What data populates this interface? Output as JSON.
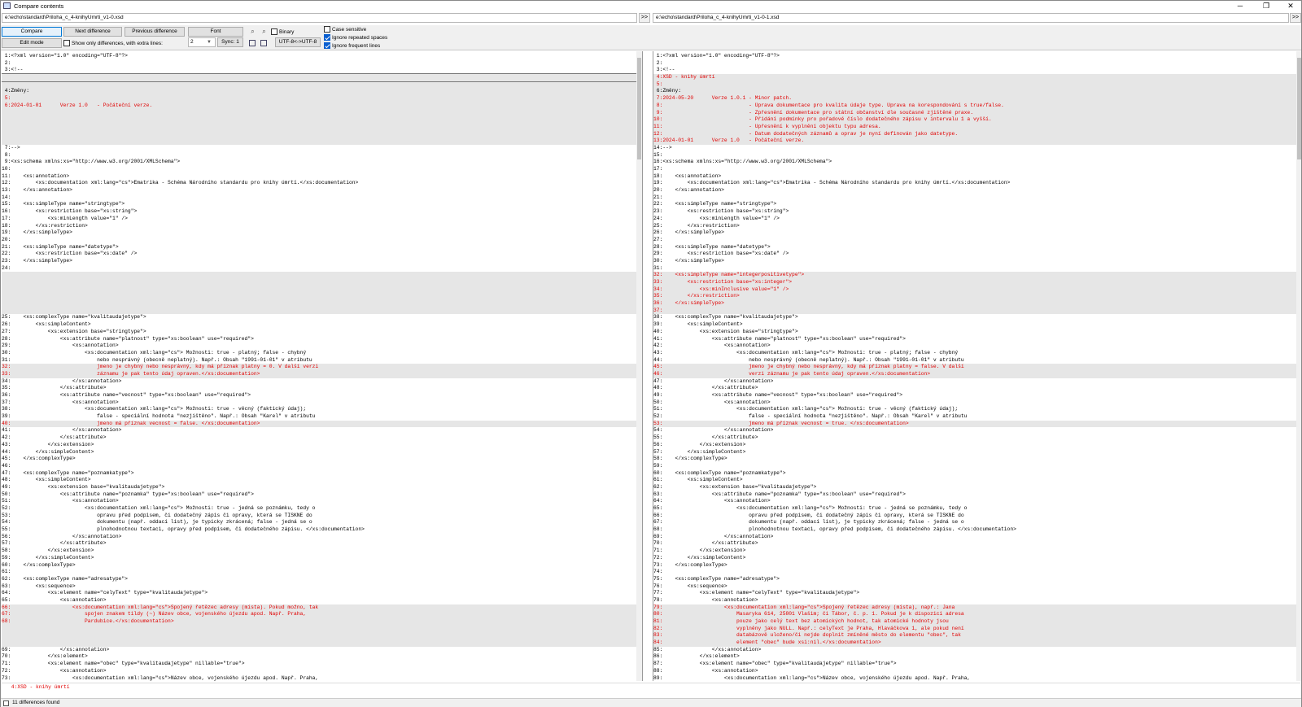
{
  "window": {
    "title": "Compare contents",
    "minimize": "─",
    "maximize": "❐",
    "close": "✕"
  },
  "paths": {
    "left": "e:\\echo\\standard\\Priloha_c_4-knihyUmrti_v1-0.xsd",
    "right": "e:\\echo\\standard\\Priloha_c_4-knihyUmrti_v1-0-1.xsd",
    "go_label": ">>"
  },
  "toolbar": {
    "compare": "Compare",
    "next_difference": "Next difference",
    "previous_difference": "Previous difference",
    "font": "Font",
    "edit_mode": "Edit mode",
    "sync": "Sync: 1",
    "encoding": "UTF-8<->UTF-8",
    "binary": "Binary",
    "show_only_differences": "Show only differences, with extra lines:",
    "context_lines": "2",
    "case_sensitive": "Case sensitive",
    "ignore_repeated_spaces": "Ignore repeated spaces",
    "ignore_frequent_lines": "Ignore frequent lines"
  },
  "checkbox_states": {
    "binary": false,
    "show_only_differences": false,
    "case_sensitive": false,
    "ignore_repeated_spaces": true,
    "ignore_frequent_lines": true
  },
  "left_lines": [
    {
      "t": " 1:<?xml version=\"1.0\" encoding=\"UTF-8\"?>"
    },
    {
      "t": " 2:"
    },
    {
      "t": " 3:<!--"
    },
    {
      "t": "",
      "d": true,
      "cur": true
    },
    {
      "t": "",
      "d": true
    },
    {
      "t": " 4:Změny:",
      "d": true
    },
    {
      "t": " 5:",
      "d": true,
      "r": true
    },
    {
      "t": " 6:2024-01-01      Verze 1.0   - Počáteční verze.",
      "d": true,
      "r": true
    },
    {
      "t": "",
      "d": true
    },
    {
      "t": "",
      "d": true
    },
    {
      "t": "",
      "d": true
    },
    {
      "t": "",
      "d": true
    },
    {
      "t": "",
      "d": true
    },
    {
      "t": " 7:-->"
    },
    {
      "t": " 8:"
    },
    {
      "t": " 9:<xs:schema xmlns:xs=\"http://www.w3.org/2001/XMLSchema\">"
    },
    {
      "t": "10:"
    },
    {
      "t": "11:    <xs:annotation>"
    },
    {
      "t": "12:        <xs:documentation xml:lang=\"cs\">Ematrika - Schéma Národního standardu pro knihy úmrtí.</xs:documentation>"
    },
    {
      "t": "13:    </xs:annotation>"
    },
    {
      "t": "14:"
    },
    {
      "t": "15:    <xs:simpleType name=\"stringtype\">"
    },
    {
      "t": "16:        <xs:restriction base=\"xs:string\">"
    },
    {
      "t": "17:            <xs:minLength value=\"1\" />"
    },
    {
      "t": "18:        </xs:restriction>"
    },
    {
      "t": "19:    </xs:simpleType>"
    },
    {
      "t": "20:"
    },
    {
      "t": "21:    <xs:simpleType name=\"datetype\">"
    },
    {
      "t": "22:        <xs:restriction base=\"xs:date\" />"
    },
    {
      "t": "23:    </xs:simpleType>"
    },
    {
      "t": "24:"
    },
    {
      "t": "",
      "d": true
    },
    {
      "t": "",
      "d": true
    },
    {
      "t": "",
      "d": true
    },
    {
      "t": "",
      "d": true
    },
    {
      "t": "",
      "d": true
    },
    {
      "t": "",
      "d": true
    },
    {
      "t": "25:    <xs:complexType name=\"kvalitaudajetype\">"
    },
    {
      "t": "26:        <xs:simpleContent>"
    },
    {
      "t": "27:            <xs:extension base=\"stringtype\">"
    },
    {
      "t": "28:                <xs:attribute name=\"platnost\" type=\"xs:boolean\" use=\"required\">"
    },
    {
      "t": "29:                    <xs:annotation>"
    },
    {
      "t": "30:                        <xs:documentation xml:lang=\"cs\"> Možnosti: true - platný; false - chybný"
    },
    {
      "t": "31:                            nebo nesprávný (obecně neplatný). Např.: Obsah \"1991-01-01\" v atributu"
    },
    {
      "t": "32:                            jmeno je chybný nebo nesprávný, kdy má příznak platny = 0. V další verzi",
      "d": true,
      "r": true
    },
    {
      "t": "33:                            záznamu je pak tento údaj opraven.</xs:documentation>",
      "d": true,
      "r": true
    },
    {
      "t": "34:                    </xs:annotation>"
    },
    {
      "t": "35:                </xs:attribute>"
    },
    {
      "t": "36:                <xs:attribute name=\"vecnost\" type=\"xs:boolean\" use=\"required\">"
    },
    {
      "t": "37:                    <xs:annotation>"
    },
    {
      "t": "38:                        <xs:documentation xml:lang=\"cs\"> Možnosti: true - věcný (faktický údaj);"
    },
    {
      "t": "39:                            false - speciální hodnota \"nezjištěno\". Např.: Obsah \"Karel\" v atributu"
    },
    {
      "t": "40:                            jmeno má příznak vecnost = false. </xs:documentation>",
      "d": true,
      "r": true
    },
    {
      "t": "41:                    </xs:annotation>"
    },
    {
      "t": "42:                </xs:attribute>"
    },
    {
      "t": "43:            </xs:extension>"
    },
    {
      "t": "44:        </xs:simpleContent>"
    },
    {
      "t": "45:    </xs:complexType>"
    },
    {
      "t": "46:"
    },
    {
      "t": "47:    <xs:complexType name=\"poznamkatype\">"
    },
    {
      "t": "48:        <xs:simpleContent>"
    },
    {
      "t": "49:            <xs:extension base=\"kvalitaudajetype\">"
    },
    {
      "t": "50:                <xs:attribute name=\"poznamka\" type=\"xs:boolean\" use=\"required\">"
    },
    {
      "t": "51:                    <xs:annotation>"
    },
    {
      "t": "52:                        <xs:documentation xml:lang=\"cs\"> Možnosti: true - jedná se poznámku, tedy o"
    },
    {
      "t": "53:                            opravu před podpisem, či dodatečný zápis či opravy, která se TISKNE do"
    },
    {
      "t": "54:                            dokumentu (např. oddací list), je typicky zkrácená; false - jedná se o"
    },
    {
      "t": "55:                            plnohodnotnou textaci, opravy před podpisem, či dodatečného zápisu. </xs:documentation>"
    },
    {
      "t": "56:                    </xs:annotation>"
    },
    {
      "t": "57:                </xs:attribute>"
    },
    {
      "t": "58:            </xs:extension>"
    },
    {
      "t": "59:        </xs:simpleContent>"
    },
    {
      "t": "60:    </xs:complexType>"
    },
    {
      "t": "61:"
    },
    {
      "t": "62:    <xs:complexType name=\"adresatype\">"
    },
    {
      "t": "63:        <xs:sequence>"
    },
    {
      "t": "64:            <xs:element name=\"celyText\" type=\"kvalitaudajetype\">"
    },
    {
      "t": "65:                <xs:annotation>"
    },
    {
      "t": "66:                    <xs:documentation xml:lang=\"cs\">Spojený řetězec adresy (místa). Pokud možno, tak",
      "d": true,
      "r": true
    },
    {
      "t": "67:                        spojen znakem tildy (~) Název obce, vojenského újezdu apod. Např. Praha,",
      "d": true,
      "r": true
    },
    {
      "t": "68:                        Pardubice.</xs:documentation>",
      "d": true,
      "r": true
    },
    {
      "t": "",
      "d": true
    },
    {
      "t": "",
      "d": true
    },
    {
      "t": "",
      "d": true
    },
    {
      "t": "69:                </xs:annotation>"
    },
    {
      "t": "70:            </xs:element>"
    },
    {
      "t": "71:            <xs:element name=\"obec\" type=\"kvalitaudajetype\" nillable=\"true\">"
    },
    {
      "t": "72:                <xs:annotation>"
    },
    {
      "t": "73:                    <xs:documentation xml:lang=\"cs\">Název obce, vojenského újezdu apod. Např. Praha,"
    }
  ],
  "right_lines": [
    {
      "t": " 1:<?xml version=\"1.0\" encoding=\"UTF-8\"?>"
    },
    {
      "t": " 2:"
    },
    {
      "t": " 3:<!--"
    },
    {
      "t": " 4:XSD - knihy úmrtí",
      "d": true,
      "r": true
    },
    {
      "t": " 5:",
      "d": true,
      "r": true
    },
    {
      "t": " 6:Změny:",
      "d": true
    },
    {
      "t": " 7:2024-05-20      Verze 1.0.1 - Minor patch.",
      "d": true,
      "r": true
    },
    {
      "t": " 8:                            - Úprava dokumentace pro kvalita údaje type. Úprava na korespondování s true/false.",
      "d": true,
      "r": true
    },
    {
      "t": " 9:                            - Zpřesnění dokumentace pro státní občanství dle současné zjištěné praxe.",
      "d": true,
      "r": true
    },
    {
      "t": "10:                            - Přidání podmínky pro pořadové číslo dodatečného zápisu v intervalu 1 a vyšší.",
      "d": true,
      "r": true
    },
    {
      "t": "11:                            - Upřesnění k vyplnění objektu typu adresa.",
      "d": true,
      "r": true
    },
    {
      "t": "12:                            - Datum dodatečných záznamů a oprav je nyní definován jako datetype.",
      "d": true,
      "r": true
    },
    {
      "t": "13:2024-01-01      Verze 1.0   - Počáteční verze.",
      "d": true,
      "r": true
    },
    {
      "t": "14:-->"
    },
    {
      "t": "15:"
    },
    {
      "t": "16:<xs:schema xmlns:xs=\"http://www.w3.org/2001/XMLSchema\">"
    },
    {
      "t": "17:"
    },
    {
      "t": "18:    <xs:annotation>"
    },
    {
      "t": "19:        <xs:documentation xml:lang=\"cs\">Ematrika - Schéma Národního standardu pro knihy úmrtí.</xs:documentation>"
    },
    {
      "t": "20:    </xs:annotation>"
    },
    {
      "t": "21:"
    },
    {
      "t": "22:    <xs:simpleType name=\"stringtype\">"
    },
    {
      "t": "23:        <xs:restriction base=\"xs:string\">"
    },
    {
      "t": "24:            <xs:minLength value=\"1\" />"
    },
    {
      "t": "25:        </xs:restriction>"
    },
    {
      "t": "26:    </xs:simpleType>"
    },
    {
      "t": "27:"
    },
    {
      "t": "28:    <xs:simpleType name=\"datetype\">"
    },
    {
      "t": "29:        <xs:restriction base=\"xs:date\" />"
    },
    {
      "t": "30:    </xs:simpleType>"
    },
    {
      "t": "31:"
    },
    {
      "t": "32:    <xs:simpleType name=\"integerpositivetype\">",
      "d": true,
      "r": true
    },
    {
      "t": "33:        <xs:restriction base=\"xs:integer\">",
      "d": true,
      "r": true
    },
    {
      "t": "34:            <xs:minInclusive value=\"1\" />",
      "d": true,
      "r": true
    },
    {
      "t": "35:        </xs:restriction>",
      "d": true,
      "r": true
    },
    {
      "t": "36:    </xs:simpleType>",
      "d": true,
      "r": true
    },
    {
      "t": "37:",
      "d": true,
      "r": true
    },
    {
      "t": "38:    <xs:complexType name=\"kvalitaudajetype\">"
    },
    {
      "t": "39:        <xs:simpleContent>"
    },
    {
      "t": "40:            <xs:extension base=\"stringtype\">"
    },
    {
      "t": "41:                <xs:attribute name=\"platnost\" type=\"xs:boolean\" use=\"required\">"
    },
    {
      "t": "42:                    <xs:annotation>"
    },
    {
      "t": "43:                        <xs:documentation xml:lang=\"cs\"> Možnosti: true - platný; false - chybný"
    },
    {
      "t": "44:                            nebo nesprávný (obecně neplatný). Např.: Obsah \"1991-01-01\" v atributu"
    },
    {
      "t": "45:                            jmeno je chybný nebo nesprávný, kdy má příznak platny = false. V další",
      "d": true,
      "r": true
    },
    {
      "t": "46:                            verzi záznamu je pak tento údaj opraven.</xs:documentation>",
      "d": true,
      "r": true
    },
    {
      "t": "47:                    </xs:annotation>"
    },
    {
      "t": "48:                </xs:attribute>"
    },
    {
      "t": "49:                <xs:attribute name=\"vecnost\" type=\"xs:boolean\" use=\"required\">"
    },
    {
      "t": "50:                    <xs:annotation>"
    },
    {
      "t": "51:                        <xs:documentation xml:lang=\"cs\"> Možnosti: true - věcný (faktický údaj);"
    },
    {
      "t": "52:                            false - speciální hodnota \"nezjištěno\". Např.: Obsah \"Karel\" v atributu"
    },
    {
      "t": "53:                            jmeno má příznak vecnost = true. </xs:documentation>",
      "d": true,
      "r": true
    },
    {
      "t": "54:                    </xs:annotation>"
    },
    {
      "t": "55:                </xs:attribute>"
    },
    {
      "t": "56:            </xs:extension>"
    },
    {
      "t": "57:        </xs:simpleContent>"
    },
    {
      "t": "58:    </xs:complexType>"
    },
    {
      "t": "59:"
    },
    {
      "t": "60:    <xs:complexType name=\"poznamkatype\">"
    },
    {
      "t": "61:        <xs:simpleContent>"
    },
    {
      "t": "62:            <xs:extension base=\"kvalitaudajetype\">"
    },
    {
      "t": "63:                <xs:attribute name=\"poznamka\" type=\"xs:boolean\" use=\"required\">"
    },
    {
      "t": "64:                    <xs:annotation>"
    },
    {
      "t": "65:                        <xs:documentation xml:lang=\"cs\"> Možnosti: true - jedná se poznámku, tedy o"
    },
    {
      "t": "66:                            opravu před podpisem, či dodatečný zápis či opravy, která se TISKNE do"
    },
    {
      "t": "67:                            dokumentu (např. oddací list), je typicky zkrácená; false - jedná se o"
    },
    {
      "t": "68:                            plnohodnotnou textaci, opravy před podpisem, či dodatečného zápisu. </xs:documentation>"
    },
    {
      "t": "69:                    </xs:annotation>"
    },
    {
      "t": "70:                </xs:attribute>"
    },
    {
      "t": "71:            </xs:extension>"
    },
    {
      "t": "72:        </xs:simpleContent>"
    },
    {
      "t": "73:    </xs:complexType>"
    },
    {
      "t": "74:"
    },
    {
      "t": "75:    <xs:complexType name=\"adresatype\">"
    },
    {
      "t": "76:        <xs:sequence>"
    },
    {
      "t": "77:            <xs:element name=\"celyText\" type=\"kvalitaudajetype\">"
    },
    {
      "t": "78:                <xs:annotation>"
    },
    {
      "t": "79:                    <xs:documentation xml:lang=\"cs\">Spojený řetězec adresy (místa), např.: Jana",
      "d": true,
      "r": true
    },
    {
      "t": "80:                        Masaryka 614, 25801 Vlašim; či Tábor, č. p. 1. Pokud je k dispozici adresa",
      "d": true,
      "r": true
    },
    {
      "t": "81:                        pouze jako celý text bez atomických hodnot, tak atomické hodnoty jsou",
      "d": true,
      "r": true
    },
    {
      "t": "82:                        vyplněny jako NULL. Např.: celyText je Praha, Hlaváčkova 1, ale pokud není",
      "d": true,
      "r": true
    },
    {
      "t": "83:                        databázově uloženo/či nejde doplnit zmíněné město do elementu \"obec\", tak",
      "d": true,
      "r": true
    },
    {
      "t": "84:                        element \"obec\" bude xsi:nil.</xs:documentation>",
      "d": true,
      "r": true
    },
    {
      "t": "85:                </xs:annotation>"
    },
    {
      "t": "86:            </xs:element>"
    },
    {
      "t": "87:            <xs:element name=\"obec\" type=\"kvalitaudajetype\" nillable=\"true\">"
    },
    {
      "t": "88:                <xs:annotation>"
    },
    {
      "t": "89:                    <xs:documentation xml:lang=\"cs\">Název obce, vojenského újezdu apod. Např. Praha,"
    }
  ],
  "bottom_line": " 4:XSD - knihy úmrtí",
  "status": "11 differences found",
  "colors": {
    "diff_background": "#e6e6e6",
    "diff_text": "#e00000",
    "toolbar_bg": "#f0f0f0",
    "accent": "#0078d7"
  }
}
